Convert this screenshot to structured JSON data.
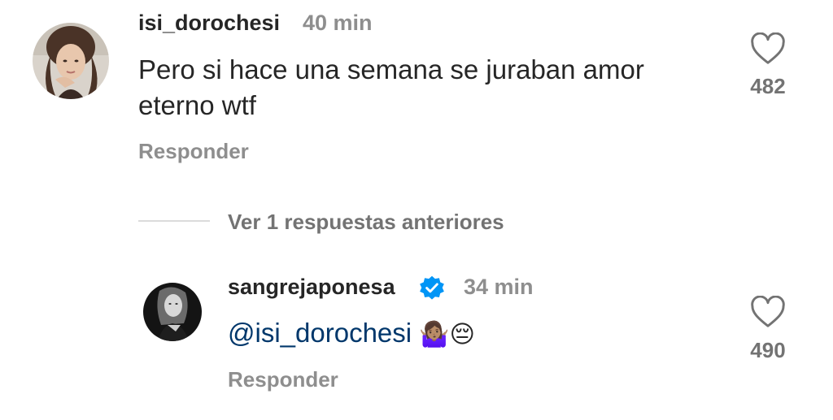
{
  "comment": {
    "username": "isi_dorochesi",
    "time": "40 min",
    "text_line1": "Pero si hace una semana se juraban amor",
    "text_line2": "eterno wtf",
    "reply_label": "Responder",
    "like_count": "482",
    "avatar_icon": "profile-photo"
  },
  "view_previous_replies": "Ver 1 respuestas anteriores",
  "reply": {
    "username": "sangrejaponesa",
    "verified": true,
    "verified_icon": "verified-badge-icon",
    "time": "34 min",
    "mention": "@isi_dorochesi",
    "emoji_1": "🤷🏽‍♀️",
    "emoji_2": "😔",
    "reply_label": "Responder",
    "like_count": "490",
    "avatar_icon": "profile-photo"
  },
  "colors": {
    "text_primary": "#262626",
    "text_secondary": "#8e8e8e",
    "mention": "#00376b",
    "verified": "#0095f6",
    "divider": "#dbdbdb"
  }
}
